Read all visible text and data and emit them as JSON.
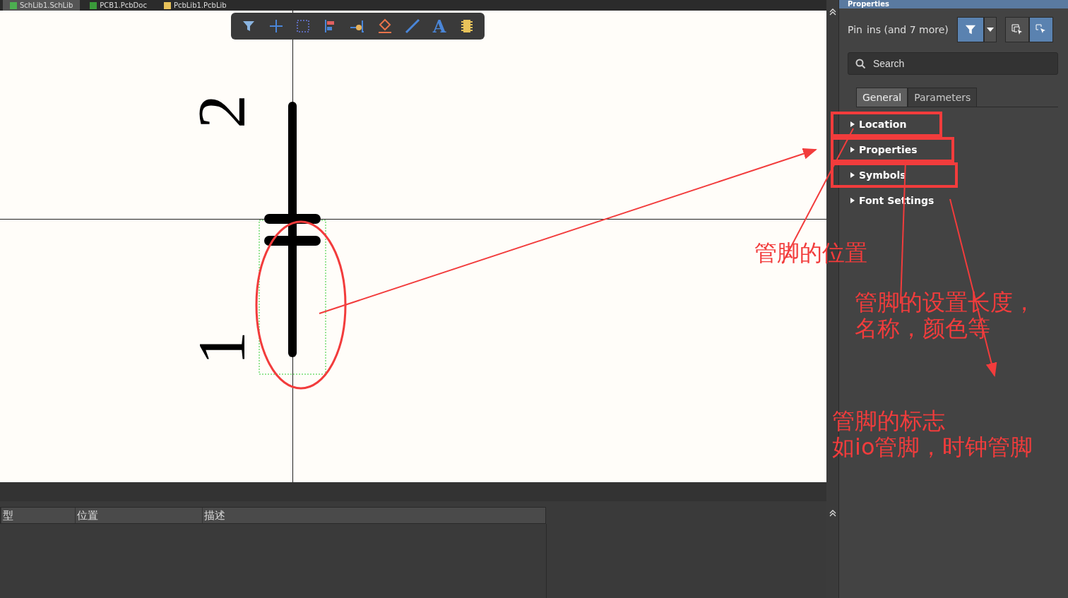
{
  "document_tabs": [
    {
      "label": "SchLib1.SchLib",
      "kind": "sch",
      "selected": true
    },
    {
      "label": "PCB1.PcbDoc",
      "kind": "pcb",
      "selected": false
    },
    {
      "label": "PcbLib1.PcbLib",
      "kind": "lib",
      "selected": false
    }
  ],
  "toolbar": [
    {
      "kind": "filter"
    },
    {
      "kind": "move"
    },
    {
      "kind": "select"
    },
    {
      "kind": "align"
    },
    {
      "kind": "pin"
    },
    {
      "kind": "fill"
    },
    {
      "kind": "line"
    },
    {
      "kind": "text",
      "glyph": "A"
    },
    {
      "kind": "part"
    }
  ],
  "canvas": {
    "pin_numbers": [
      "2",
      "1"
    ]
  },
  "bottom_table": {
    "columns": [
      "型",
      "位置",
      "描述"
    ]
  },
  "properties_panel": {
    "title": "Properties",
    "object": "Pin",
    "selection": "ins (and 7 more)",
    "buttons": [
      {
        "kind": "filter",
        "selected": true
      },
      {
        "kind": "dropdown",
        "selected": false
      },
      {
        "kind": "select-add",
        "selected": false
      },
      {
        "kind": "select-one",
        "selected": true
      }
    ],
    "search": {
      "placeholder": "Search"
    },
    "tabs": [
      {
        "label": "General",
        "selected": true
      },
      {
        "label": "Parameters",
        "selected": false
      }
    ],
    "sections": [
      {
        "label": "Location",
        "expanded": false,
        "annotated": true
      },
      {
        "label": "Properties",
        "expanded": false,
        "annotated": true
      },
      {
        "label": "Symbols",
        "expanded": false,
        "annotated": true
      },
      {
        "label": "Font Settings",
        "expanded": false,
        "annotated": false
      }
    ]
  },
  "annotations": [
    {
      "lines": [
        "管脚的位置"
      ]
    },
    {
      "lines": [
        "管脚的设置长度，",
        "名称，颜色等"
      ]
    },
    {
      "lines": [
        "管脚的标志",
        "如io管脚，时钟管脚"
      ]
    }
  ]
}
